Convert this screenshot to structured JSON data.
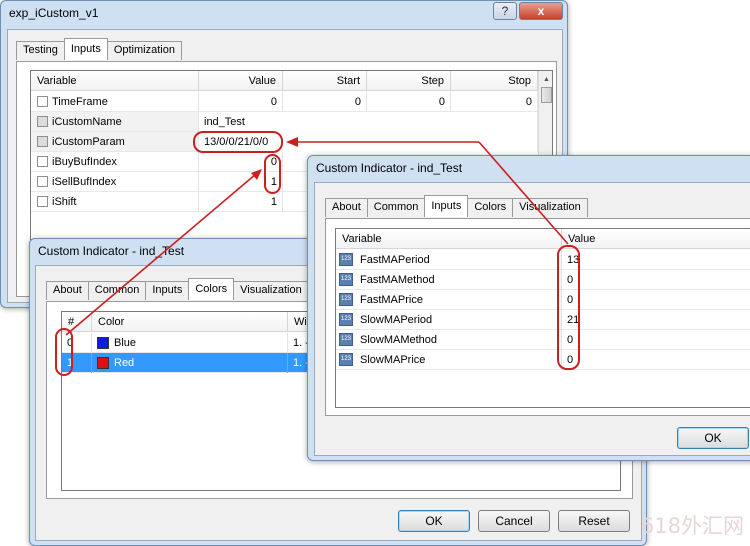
{
  "main_window": {
    "title": "exp_iCustom_v1",
    "caption_buttons": {
      "help": "?",
      "close": "x"
    },
    "tabs": [
      "Testing",
      "Inputs",
      "Optimization"
    ],
    "active_tab": "Inputs",
    "columns": [
      "Variable",
      "Value",
      "Start",
      "Step",
      "Stop"
    ],
    "rows": [
      {
        "name": "TimeFrame",
        "value": "0",
        "start": "0",
        "step": "0",
        "stop": "0"
      },
      {
        "name": "iCustomName",
        "value": "ind_Test",
        "start": "",
        "step": "",
        "stop": ""
      },
      {
        "name": "iCustomParam",
        "value": "13/0/0/21/0/0",
        "start": "",
        "step": "",
        "stop": ""
      },
      {
        "name": "iBuyBufIndex",
        "value": "0",
        "start": "",
        "step": "",
        "stop": ""
      },
      {
        "name": "iSellBufIndex",
        "value": "1",
        "start": "",
        "step": "",
        "stop": ""
      },
      {
        "name": "iShift",
        "value": "1",
        "start": "",
        "step": "",
        "stop": ""
      }
    ]
  },
  "colors_dialog": {
    "title": "Custom Indicator - ind_Test",
    "tabs": [
      "About",
      "Common",
      "Inputs",
      "Colors",
      "Visualization"
    ],
    "active_tab": "Colors",
    "columns": [
      "#",
      "Color",
      "Wid"
    ],
    "rows": [
      {
        "index": "0",
        "color_name": "Blue",
        "swatch": "#0a1fd8",
        "width": "1. --"
      },
      {
        "index": "1",
        "color_name": "Red",
        "swatch": "#e01010",
        "width": "1. --"
      }
    ],
    "buttons": {
      "ok": "OK",
      "cancel": "Cancel",
      "reset": "Reset"
    }
  },
  "inputs_dialog": {
    "title": "Custom Indicator - ind_Test",
    "tabs": [
      "About",
      "Common",
      "Inputs",
      "Colors",
      "Visualization"
    ],
    "active_tab": "Inputs",
    "columns": [
      "Variable",
      "Value"
    ],
    "rows": [
      {
        "name": "FastMAPeriod",
        "value": "13"
      },
      {
        "name": "FastMAMethod",
        "value": "0"
      },
      {
        "name": "FastMAPrice",
        "value": "0"
      },
      {
        "name": "SlowMAPeriod",
        "value": "21"
      },
      {
        "name": "SlowMAMethod",
        "value": "0"
      },
      {
        "name": "SlowMAPrice",
        "value": "0"
      }
    ],
    "ok_label": "OK",
    "icon_text": "123"
  },
  "watermark": "618外汇网",
  "colors": {
    "annotation": "#cc1f1f",
    "selection": "#3399ff",
    "title_bar": "#cfe0f3"
  }
}
